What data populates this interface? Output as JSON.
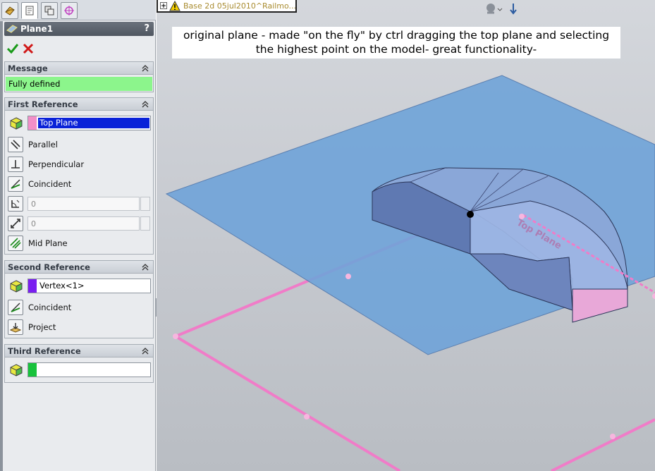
{
  "panel": {
    "title": "Plane1",
    "help": "?",
    "message_group": {
      "title": "Message",
      "text": "Fully defined"
    },
    "first_reference": {
      "title": "First Reference",
      "selection": "Top Plane",
      "options": [
        "Parallel",
        "Perpendicular",
        "Coincident"
      ],
      "angle_value": "0",
      "distance_value": "0",
      "mid_plane": "Mid Plane"
    },
    "second_reference": {
      "title": "Second Reference",
      "selection": "Vertex<1>",
      "options": [
        "Coincident",
        "Project"
      ]
    },
    "third_reference": {
      "title": "Third Reference",
      "selection": ""
    }
  },
  "viewport": {
    "tree_item": "Base 2d 05jul2010^Railmo...",
    "annotation_line1": "original plane - made \"on the fly\" by ctrl dragging the top plane and selecting",
    "annotation_line2": "the highest point on the model- great functionality-",
    "plane_label": "Top Plane"
  },
  "colors": {
    "message_bg": "#8cf58c",
    "first_ref_swatch": "#f28fc8",
    "second_ref_swatch": "#7a1ff0",
    "third_ref_swatch": "#18c23c",
    "selection_highlight": "#0a22d8",
    "new_plane": "#6fa3d8",
    "top_plane_edge": "#f07cc8"
  },
  "icons": [
    "ok-check-icon",
    "cancel-x-icon",
    "plane-icon",
    "cube-icon",
    "parallel-icon",
    "perpendicular-icon",
    "coincident-icon",
    "angle-icon",
    "distance-icon",
    "mid-plane-icon",
    "project-icon",
    "chevron-up-icon",
    "warning-icon",
    "expand-icon"
  ]
}
